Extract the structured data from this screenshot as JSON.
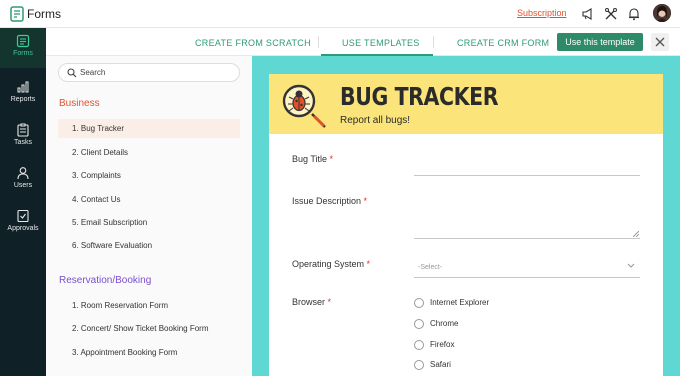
{
  "app": {
    "name": "Forms",
    "subscription_link": "Subscription"
  },
  "leftnav": {
    "items": [
      {
        "label": "Forms",
        "icon": "forms-icon",
        "active": true
      },
      {
        "label": "Reports",
        "icon": "reports-icon",
        "active": false
      },
      {
        "label": "Tasks",
        "icon": "tasks-icon",
        "active": false
      },
      {
        "label": "Users",
        "icon": "users-icon",
        "active": false
      },
      {
        "label": "Approvals",
        "icon": "approvals-icon",
        "active": false
      }
    ]
  },
  "tabs": [
    {
      "label": "CREATE FROM SCRATCH",
      "active": false
    },
    {
      "label": "USE TEMPLATES",
      "active": true
    },
    {
      "label": "CREATE CRM FORM",
      "active": false
    }
  ],
  "actions": {
    "use_template": "Use this template"
  },
  "sidebar": {
    "search_placeholder": "Search",
    "categories": [
      {
        "title": "Business",
        "color": "#e0522c",
        "items": [
          {
            "label": "1. Bug Tracker",
            "active": true
          },
          {
            "label": "2. Client Details",
            "active": false
          },
          {
            "label": "3. Complaints",
            "active": false
          },
          {
            "label": "4. Contact Us",
            "active": false
          },
          {
            "label": "5. Email Subscription",
            "active": false
          },
          {
            "label": "6. Software Evaluation",
            "active": false
          }
        ]
      },
      {
        "title": "Reservation/Booking",
        "color": "#7b4fd0",
        "items": [
          {
            "label": "1. Room Reservation Form",
            "active": false
          },
          {
            "label": "2. Concert/ Show Ticket Booking Form",
            "active": false
          },
          {
            "label": "3. Appointment Booking Form",
            "active": false
          }
        ]
      }
    ]
  },
  "preview": {
    "title": "BUG TRACKER",
    "subtitle": "Report all bugs!",
    "fields": {
      "bug_title": {
        "label": "Bug Title",
        "required": "*"
      },
      "issue_description": {
        "label": "Issue Description",
        "required": "*"
      },
      "operating_system": {
        "label": "Operating System",
        "required": "*",
        "placeholder": "-Select-"
      },
      "browser": {
        "label": "Browser",
        "required": "*",
        "options": [
          "Internet Explorer",
          "Chrome",
          "Firefox",
          "Safari"
        ]
      }
    }
  },
  "colors": {
    "accent": "#2e9c73",
    "header_bg": "#fbe57a",
    "preview_bg": "#5fd8d3",
    "nav_bg": "#0f2027"
  }
}
